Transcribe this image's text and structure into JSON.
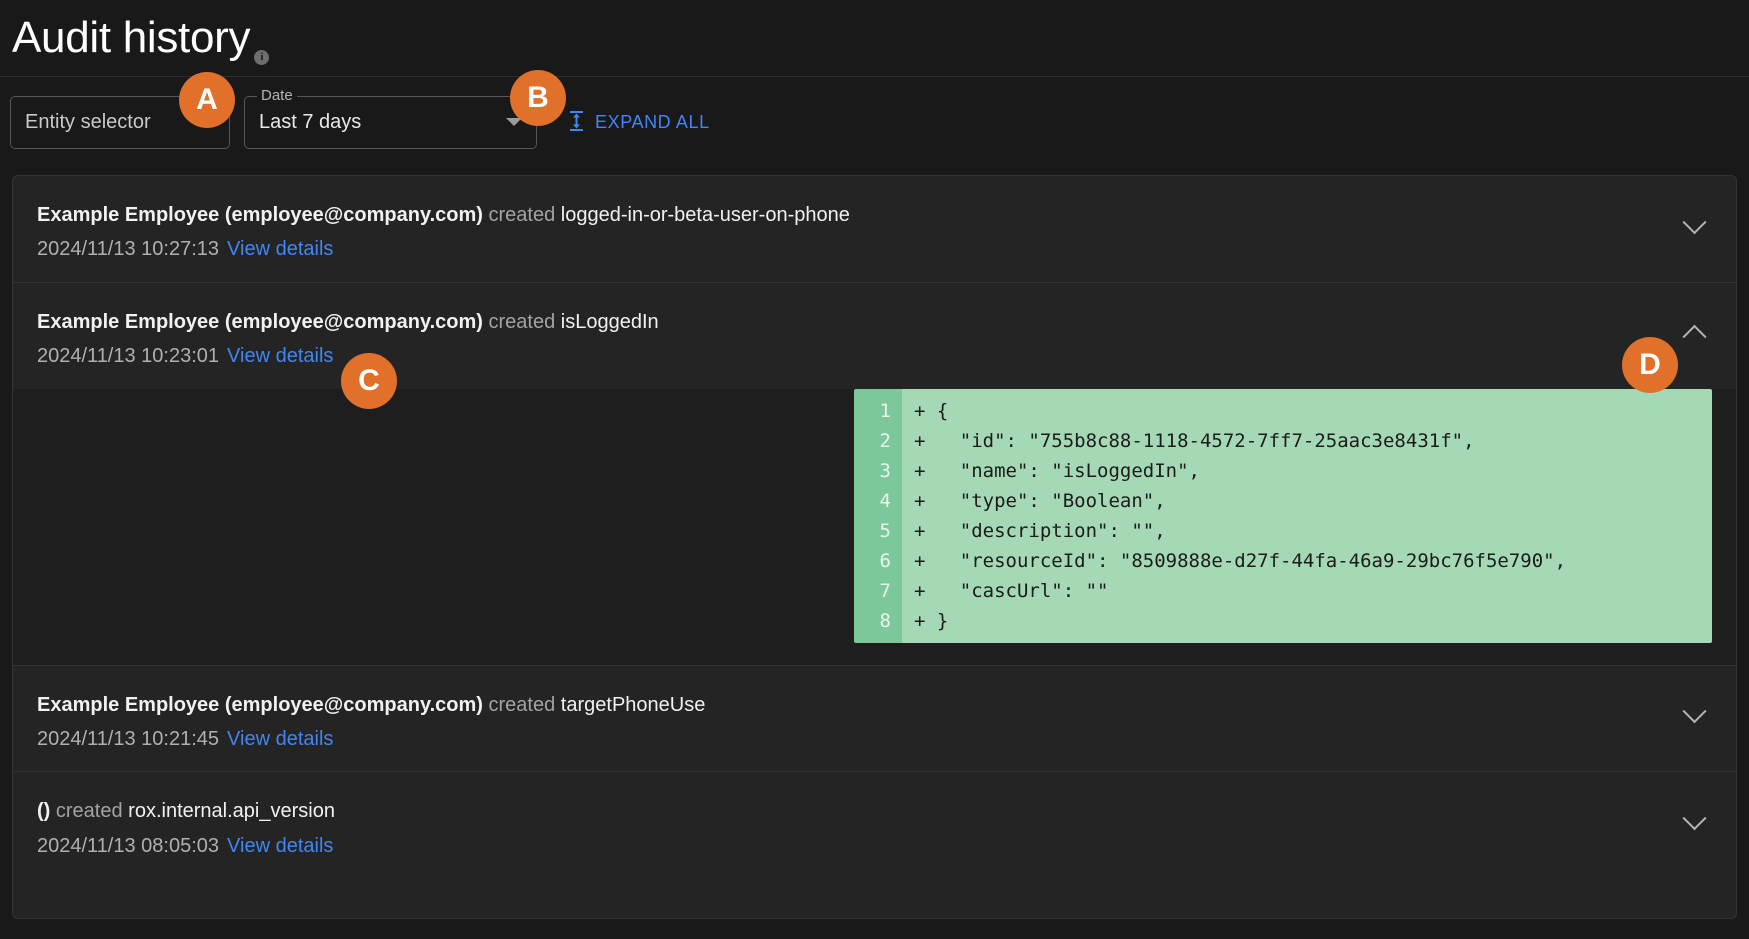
{
  "header": {
    "title": "Audit history",
    "info_glyph": "i"
  },
  "toolbar": {
    "entity_selector": {
      "value": "Entity selector",
      "caret_icon": "chevron-down-icon"
    },
    "date": {
      "legend": "Date",
      "value": "Last 7 days",
      "caret_icon": "chevron-down-icon"
    },
    "expand_all": {
      "label": "EXPAND ALL",
      "icon": "expand-vertical-icon"
    }
  },
  "rows": [
    {
      "actor": "Example Employee (employee@company.com)",
      "verb": "created",
      "subject": "logged-in-or-beta-user-on-phone",
      "timestamp": "2024/11/13 10:27:13",
      "view_details": "View details",
      "expanded": false,
      "chevron": "chevron-down-icon"
    },
    {
      "actor": "Example Employee (employee@company.com)",
      "verb": "created",
      "subject": "isLoggedIn",
      "timestamp": "2024/11/13 10:23:01",
      "view_details": "View details",
      "expanded": true,
      "chevron": "chevron-up-icon",
      "diff": {
        "line_numbers": [
          "1",
          "2",
          "3",
          "4",
          "5",
          "6",
          "7",
          "8"
        ],
        "lines": [
          "+ {",
          "+   \"id\": \"755b8c88-1118-4572-7ff7-25aac3e8431f\",",
          "+   \"name\": \"isLoggedIn\",",
          "+   \"type\": \"Boolean\",",
          "+   \"description\": \"\",",
          "+   \"resourceId\": \"8509888e-d27f-44fa-46a9-29bc76f5e790\",",
          "+   \"cascUrl\": \"\"",
          "+ }"
        ]
      }
    },
    {
      "actor": "Example Employee (employee@company.com)",
      "verb": "created",
      "subject": "targetPhoneUse",
      "timestamp": "2024/11/13 10:21:45",
      "view_details": "View details",
      "expanded": false,
      "chevron": "chevron-down-icon"
    },
    {
      "actor": "()",
      "verb": "created",
      "subject": "rox.internal.api_version",
      "timestamp": "2024/11/13 08:05:03",
      "view_details": "View details",
      "expanded": false,
      "chevron": "chevron-down-icon"
    }
  ],
  "annotations": [
    {
      "id": "A",
      "label": "A"
    },
    {
      "id": "B",
      "label": "B"
    },
    {
      "id": "C",
      "label": "C"
    },
    {
      "id": "D",
      "label": "D"
    }
  ],
  "colors": {
    "accent_link": "#4285f4",
    "badge": "#e0702a",
    "diff_add_bg": "#a5d9b6",
    "diff_gutter_bg": "#7cc89b",
    "page_bg": "#191919",
    "card_bg": "#242424"
  }
}
